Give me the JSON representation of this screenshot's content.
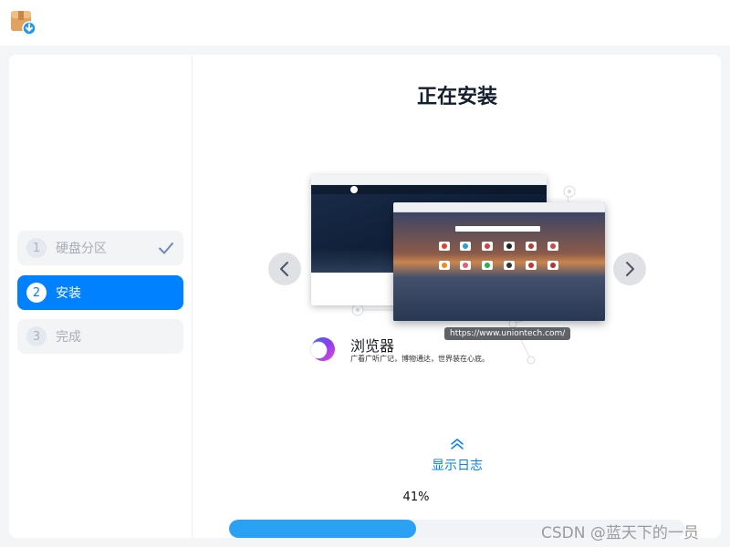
{
  "steps": [
    {
      "index": "1",
      "label": "硬盘分区",
      "state": "done"
    },
    {
      "index": "2",
      "label": "安装",
      "state": "active"
    },
    {
      "index": "3",
      "label": "完成",
      "state": "pending"
    }
  ],
  "main": {
    "title": "正在安装",
    "slide": {
      "app_name": "浏览器",
      "app_description": "广看广听广记，博物通达，世界装在心底。",
      "url": "https://www.uniontech.com/"
    },
    "log_toggle_label": "显示日志",
    "progress_text": "41%",
    "progress_value": 0.41
  },
  "watermark": "CSDN @蓝天下的一员",
  "colors": {
    "accent": "#0081ff",
    "progress_fill": "#2aa1f5",
    "background": "#f4f5f7",
    "panel": "#ffffff"
  },
  "icons": {
    "app": "installer-package-icon",
    "step_done": "check-icon",
    "prev": "chevron-left-icon",
    "next": "chevron-right-icon",
    "log": "double-chevron-up-icon",
    "browser": "browser-logo-icon"
  }
}
